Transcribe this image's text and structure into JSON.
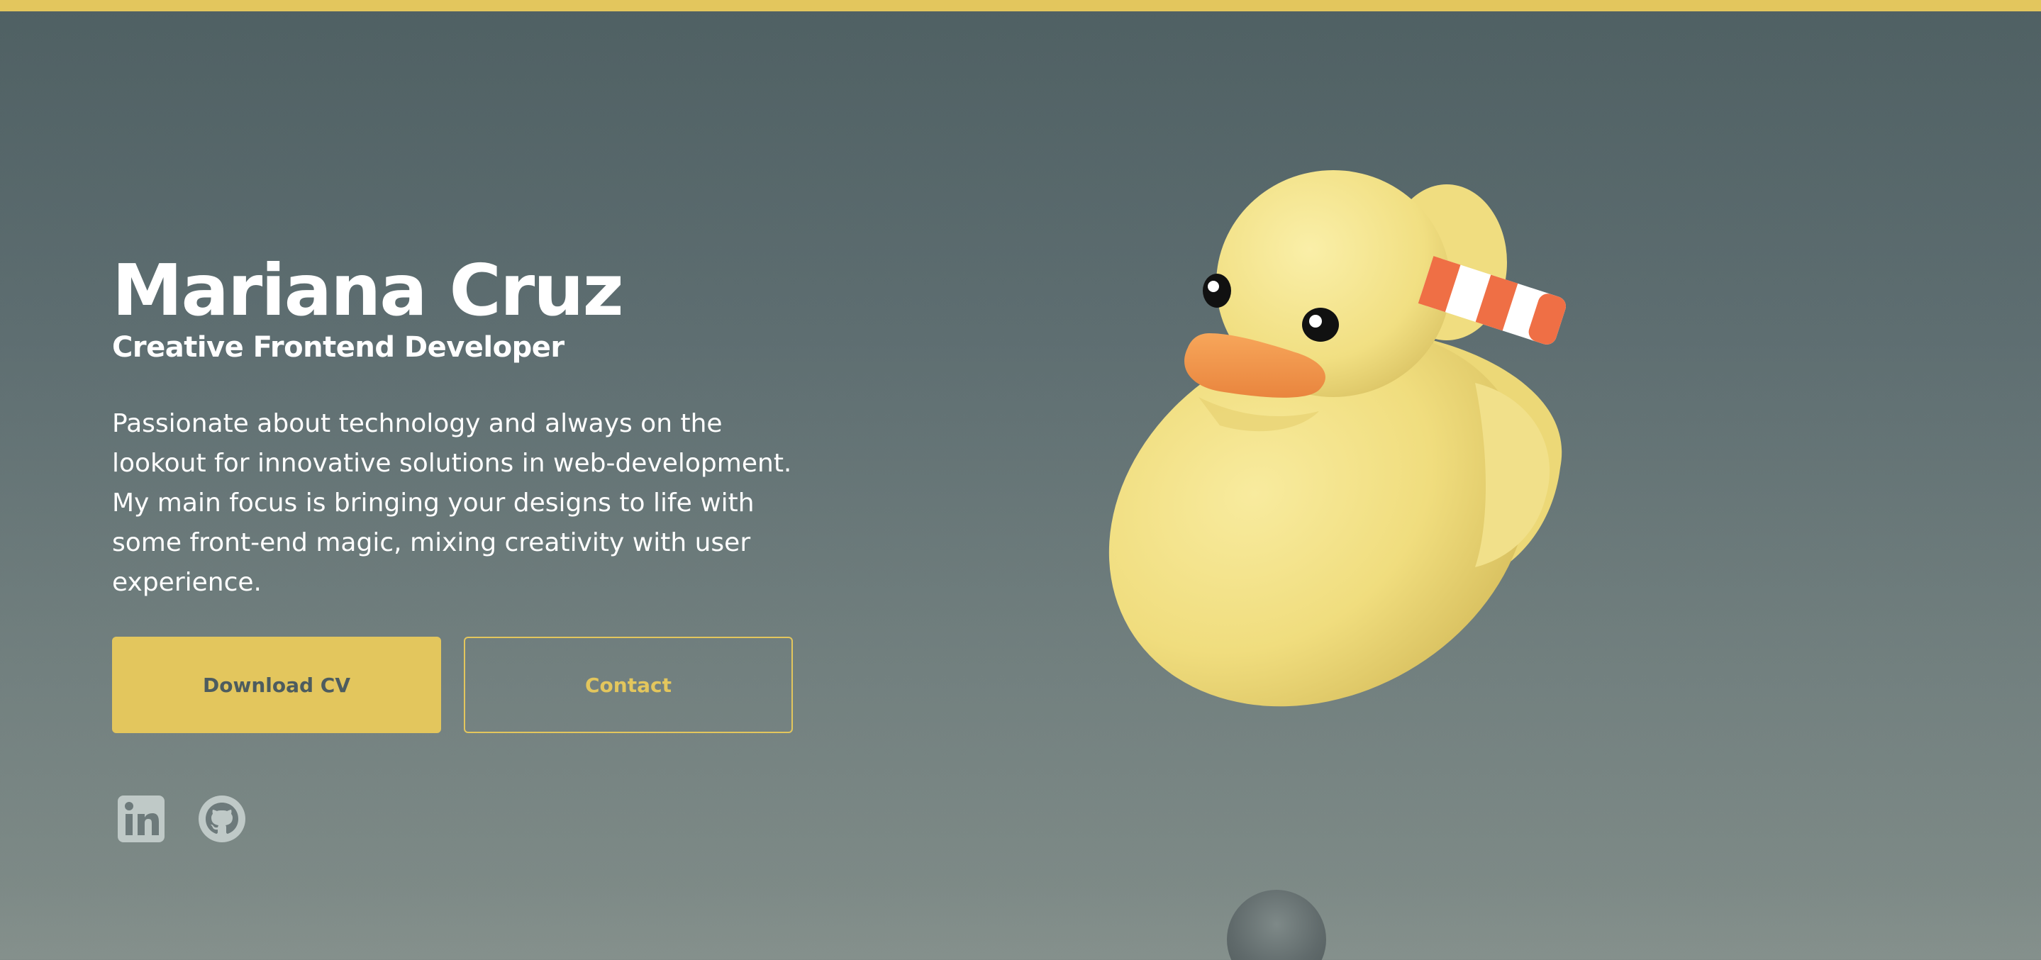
{
  "colors": {
    "accent": "#e3c65d",
    "background_top": "#4f6063",
    "background_bottom": "#818d89",
    "text": "#ffffff"
  },
  "hero": {
    "name": "Mariana Cruz",
    "role": "Creative Frontend Developer",
    "bio": "Passionate about technology and always on the lookout for innovative solutions in web-development. My main focus is bringing your designs to life with some front-end magic, mixing creativity with user experience."
  },
  "actions": {
    "download_label": "Download CV",
    "contact_label": "Contact"
  },
  "socials": [
    {
      "icon": "linkedin-icon"
    },
    {
      "icon": "github-icon"
    }
  ],
  "illustration": {
    "icon": "rubber-duck-3d"
  }
}
